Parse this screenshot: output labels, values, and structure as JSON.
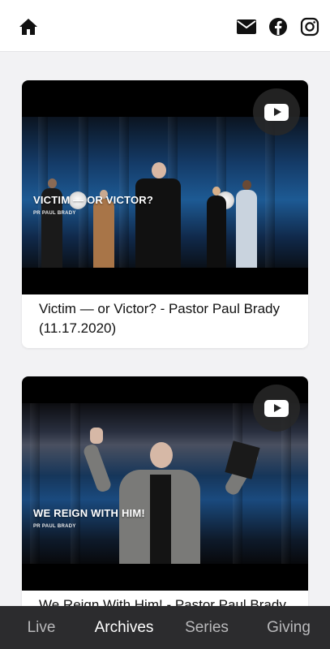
{
  "header": {
    "icons": [
      "home-icon",
      "mail-icon",
      "facebook-icon",
      "instagram-icon"
    ]
  },
  "videos": [
    {
      "overlay_title": "VICTIM — OR VICTOR?",
      "overlay_subtitle": "PR PAUL BRADY",
      "title": "Victim — or Victor? - Pastor Paul Brady (11.17.2020)",
      "badge_icon": "youtube-icon"
    },
    {
      "overlay_title": "WE REIGN WITH HIM!",
      "overlay_subtitle": "PR PAUL BRADY",
      "title": "We Reign With Him! - Pastor Paul Brady",
      "badge_icon": "youtube-icon"
    }
  ],
  "tabs": [
    {
      "label": "Live",
      "active": false
    },
    {
      "label": "Archives",
      "active": true
    },
    {
      "label": "Series",
      "active": false
    },
    {
      "label": "Giving",
      "active": false
    }
  ],
  "colors": {
    "tab_bar_bg": "#2c2c2e",
    "tab_active": "#ffffff",
    "tab_inactive": "#b9b9bb"
  }
}
